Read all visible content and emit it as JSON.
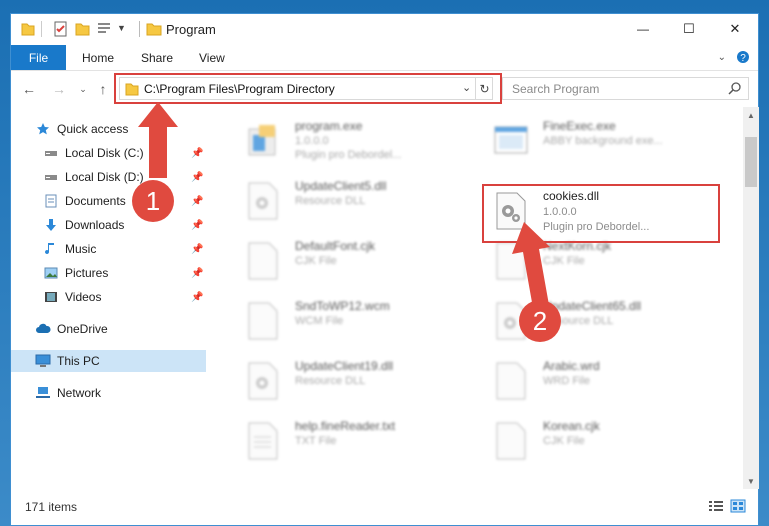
{
  "window": {
    "title": "Program",
    "controls": {
      "minimize": "—",
      "maximize": "☐",
      "close": "✕"
    }
  },
  "ribbon": {
    "tabs": [
      {
        "label": "File"
      },
      {
        "label": "Home"
      },
      {
        "label": "Share"
      },
      {
        "label": "View"
      }
    ]
  },
  "address": {
    "path": "C:\\Program Files\\Program Directory",
    "search_placeholder": "Search Program"
  },
  "sidebar": {
    "items": [
      {
        "label": "Quick access",
        "icon": "star-icon",
        "pinned": false
      },
      {
        "label": "Local Disk (C:)",
        "icon": "drive-icon",
        "pinned": true
      },
      {
        "label": "Local Disk (D:)",
        "icon": "drive-icon",
        "pinned": true
      },
      {
        "label": "Documents",
        "icon": "documents-icon",
        "pinned": true
      },
      {
        "label": "Downloads",
        "icon": "download-icon",
        "pinned": true
      },
      {
        "label": "Music",
        "icon": "music-icon",
        "pinned": true
      },
      {
        "label": "Pictures",
        "icon": "pictures-icon",
        "pinned": true
      },
      {
        "label": "Videos",
        "icon": "video-icon",
        "pinned": true
      },
      {
        "label": "OneDrive",
        "icon": "cloud-icon",
        "pinned": false
      },
      {
        "label": "This PC",
        "icon": "computer-icon",
        "pinned": false,
        "selected": true
      },
      {
        "label": "Network",
        "icon": "network-icon",
        "pinned": false
      }
    ]
  },
  "files": [
    {
      "name": "program.exe",
      "line2": "1.0.0.0",
      "line3": "Plugin pro Debordel...",
      "icon": "exe-icon",
      "blurred": true
    },
    {
      "name": "FineExec.exe",
      "line2": "ABBY background exe...",
      "line3": "",
      "icon": "exe-window-icon",
      "blurred": true
    },
    {
      "name": "UpdateClient5.dll",
      "line2": "Resource DLL",
      "line3": "",
      "icon": "dll-icon",
      "blurred": true
    },
    {
      "name": "cookies.dll",
      "line2": "1.0.0.0",
      "line3": "Plugin pro Debordel...",
      "icon": "dll-icon",
      "blurred": false
    },
    {
      "name": "DefaultFont.cjk",
      "line2": "CJK File",
      "line3": "",
      "icon": "file-icon",
      "blurred": true
    },
    {
      "name": "NextKorn.cjk",
      "line2": "CJK File",
      "line3": "",
      "icon": "file-icon",
      "blurred": true
    },
    {
      "name": "SndToWP12.wcm",
      "line2": "WCM File",
      "line3": "",
      "icon": "file-icon",
      "blurred": true
    },
    {
      "name": "UpdateClient65.dll",
      "line2": "Resource DLL",
      "line3": "",
      "icon": "dll-icon",
      "blurred": true
    },
    {
      "name": "UpdateClient19.dll",
      "line2": "Resource DLL",
      "line3": "",
      "icon": "dll-icon",
      "blurred": true
    },
    {
      "name": "Arabic.wrd",
      "line2": "WRD File",
      "line3": "",
      "icon": "file-icon",
      "blurred": true
    },
    {
      "name": "help.fineReader.txt",
      "line2": "TXT File",
      "line3": "",
      "icon": "text-file-icon",
      "blurred": true
    },
    {
      "name": "Korean.cjk",
      "line2": "CJK File",
      "line3": "",
      "icon": "file-icon",
      "blurred": true
    }
  ],
  "status": {
    "item_count": "171 items"
  },
  "callouts": {
    "one": "1",
    "two": "2"
  },
  "colors": {
    "accent": "#1979ca",
    "highlight": "#d9413d",
    "selected_bg": "#cce4f7"
  }
}
